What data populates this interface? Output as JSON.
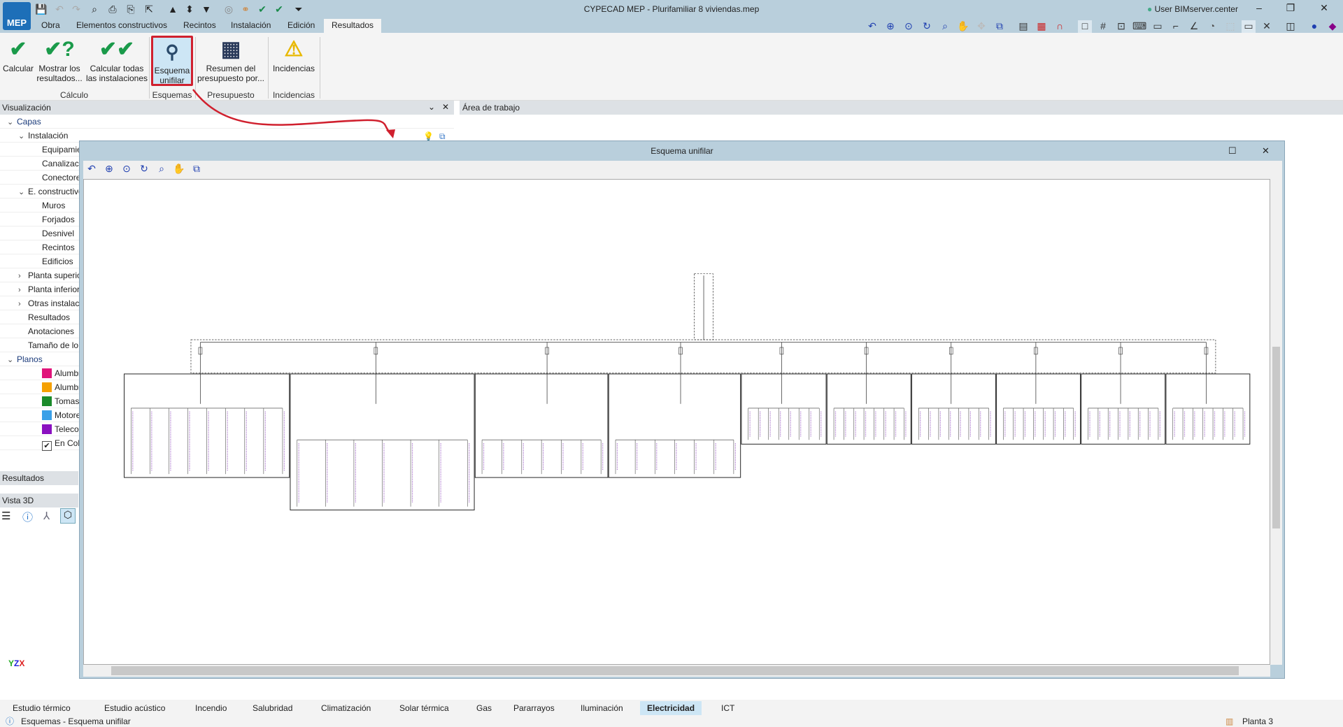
{
  "app": {
    "title": "CYPECAD MEP - Plurifamiliar 8 viviendas.mep",
    "logo": "MEP",
    "user": "User BIMserver.center"
  },
  "menu_tabs": [
    "Obra",
    "Elementos constructivos",
    "Recintos",
    "Instalación",
    "Edición",
    "Resultados"
  ],
  "active_menu_tab": "Resultados",
  "ribbon": {
    "buttons": [
      {
        "label": "Calcular",
        "icon": "check-icon"
      },
      {
        "label": "Mostrar los resultados...",
        "icon": "check-question-icon"
      },
      {
        "label": "Calcular todas las instalaciones",
        "icon": "double-check-icon"
      },
      {
        "label": "Esquema unifilar",
        "icon": "single-line-diagram-icon",
        "selected": true
      },
      {
        "label": "Resumen del presupuesto por...",
        "icon": "budget-icon"
      },
      {
        "label": "Incidencias",
        "icon": "warning-icon"
      }
    ],
    "groups": [
      "Cálculo",
      "Esquemas",
      "Presupuesto",
      "Incidencias"
    ]
  },
  "left_panel": {
    "title": "Visualización",
    "tree": [
      {
        "label": "Capas",
        "level": 0,
        "expanded": true
      },
      {
        "label": "Instalación",
        "level": 1,
        "expanded": true
      },
      {
        "label": "Equipamiento",
        "level": 2
      },
      {
        "label": "Canalizaciones",
        "level": 2
      },
      {
        "label": "Conectores",
        "level": 2
      },
      {
        "label": "E. constructivos",
        "level": 1,
        "expanded": true
      },
      {
        "label": "Muros",
        "level": 2
      },
      {
        "label": "Forjados",
        "level": 2
      },
      {
        "label": "Desnivel",
        "level": 2
      },
      {
        "label": "Recintos",
        "level": 2
      },
      {
        "label": "Edificios",
        "level": 2
      },
      {
        "label": "Planta superior",
        "level": 1,
        "collapsed": true
      },
      {
        "label": "Planta inferior",
        "level": 1,
        "collapsed": true
      },
      {
        "label": "Otras instalaciones",
        "level": 1,
        "collapsed": true
      },
      {
        "label": "Resultados",
        "level": 1
      },
      {
        "label": "Anotaciones",
        "level": 1
      },
      {
        "label": "Tamaño de lo",
        "level": 1
      },
      {
        "label": "Planos",
        "level": 0,
        "expanded": true
      },
      {
        "label": "Alumbrado",
        "level": 2,
        "color": "#e0147a"
      },
      {
        "label": "Alumbrado",
        "level": 2,
        "color": "#f5a000"
      },
      {
        "label": "Tomas",
        "level": 2,
        "color": "#1a8a2a"
      },
      {
        "label": "Motores",
        "level": 2,
        "color": "#3aa0e8"
      },
      {
        "label": "Telecomunicaciones",
        "level": 2,
        "color": "#8a10c0"
      },
      {
        "label": "En Color",
        "level": 2,
        "checkbox": true,
        "checked": true
      }
    ],
    "results_title": "Resultados",
    "view3d_title": "Vista 3D"
  },
  "work_area": {
    "title": "Área de trabajo"
  },
  "dialog": {
    "title": "Esquema unifilar"
  },
  "bottom_tabs": [
    "Estudio térmico",
    "Estudio acústico",
    "Incendio",
    "Salubridad",
    "Climatización",
    "Solar térmica",
    "Gas",
    "Pararrayos",
    "Iluminación",
    "Electricidad",
    "ICT"
  ],
  "active_bottom_tab": "Electricidad",
  "status": {
    "message": "Esquemas - Esquema unifilar",
    "floor": "Planta 3"
  },
  "colors": {
    "accent_highlight": "#d0202e",
    "titlebar": "#b9cfdc",
    "selected_tab": "#cde6f5"
  }
}
